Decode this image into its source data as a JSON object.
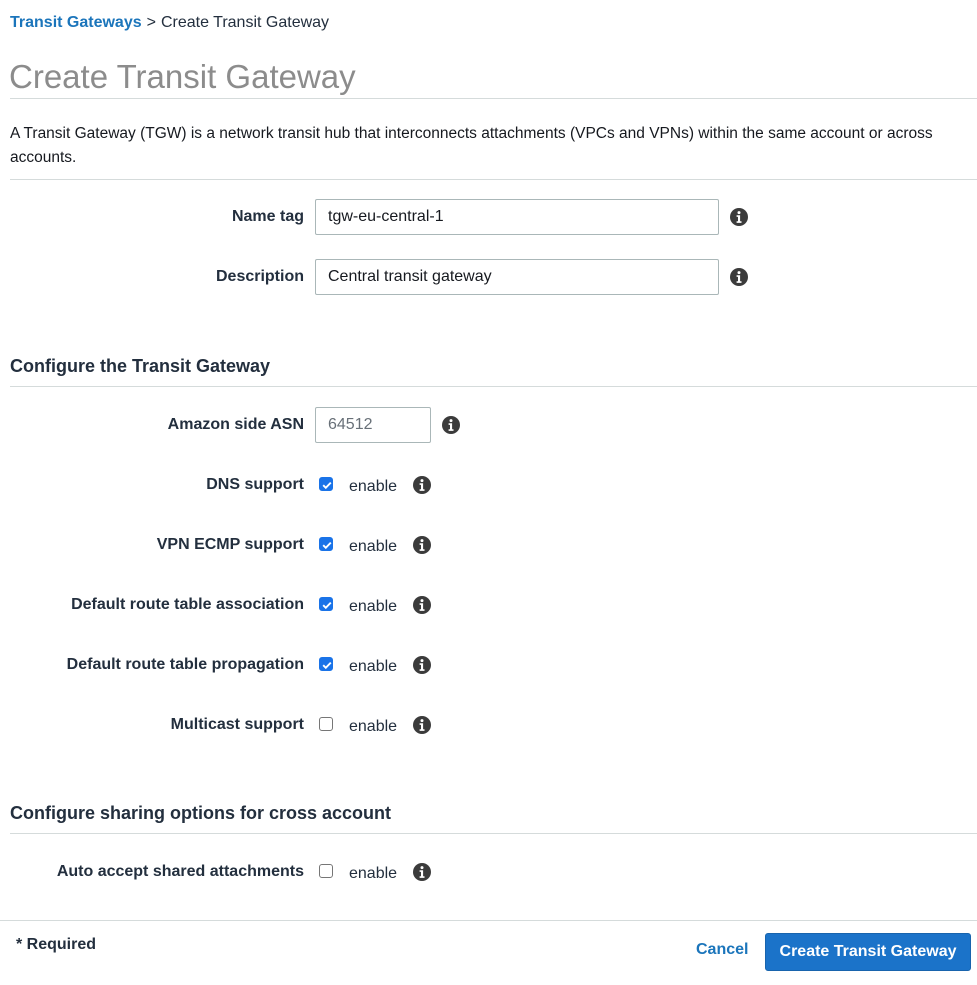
{
  "breadcrumb": {
    "parent": "Transit Gateways",
    "separator": ">",
    "current": "Create Transit Gateway"
  },
  "page_title": "Create Transit Gateway",
  "intro": "A Transit Gateway (TGW) is a network transit hub that interconnects attachments (VPCs and VPNs) within the same account or across accounts.",
  "details": {
    "name_tag": {
      "label": "Name tag",
      "value": "tgw-eu-central-1"
    },
    "description": {
      "label": "Description",
      "value": "Central transit gateway"
    }
  },
  "configure": {
    "title": "Configure the Transit Gateway",
    "asn": {
      "label": "Amazon side ASN",
      "value": "64512"
    },
    "dns": {
      "label": "DNS support",
      "checked": true,
      "text": "enable"
    },
    "vpn_ecmp": {
      "label": "VPN ECMP support",
      "checked": true,
      "text": "enable"
    },
    "rt_assoc": {
      "label": "Default route table association",
      "checked": true,
      "text": "enable"
    },
    "rt_prop": {
      "label": "Default route table propagation",
      "checked": true,
      "text": "enable"
    },
    "multicast": {
      "label": "Multicast support",
      "checked": false,
      "text": "enable"
    }
  },
  "sharing": {
    "title": "Configure sharing options for cross account",
    "auto_accept": {
      "label": "Auto accept shared attachments",
      "checked": false,
      "text": "enable"
    }
  },
  "footer": {
    "required": "* Required",
    "cancel": "Cancel",
    "create": "Create Transit Gateway"
  },
  "colors": {
    "link": "#1b75bb",
    "primary": "#1b73c9",
    "checkbox": "#1a73e8",
    "icon": "#3b3b3b"
  },
  "icons": {
    "info": "info-circle-icon",
    "check": "checkmark-icon"
  }
}
